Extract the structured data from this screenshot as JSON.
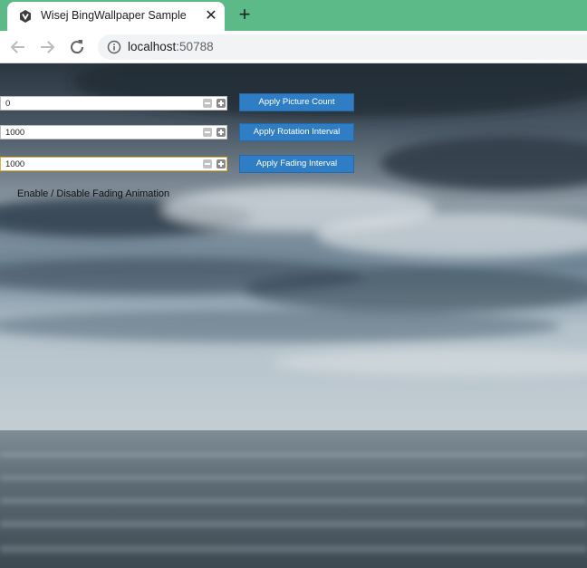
{
  "browser": {
    "tab_title": "Wisej BingWallpaper Sample",
    "close_glyph": "✕",
    "new_tab_glyph": "+",
    "url_host": "localhost",
    "url_port": ":50788",
    "icons": [
      "wisej-favicon-icon",
      "close-icon",
      "plus-icon",
      "back-arrow-icon",
      "forward-arrow-icon",
      "reload-icon",
      "info-icon"
    ]
  },
  "controls": {
    "picture_count": {
      "value": "0",
      "button_label": "Apply Picture Count"
    },
    "rotation_interval": {
      "value": "1000",
      "button_label": "Apply Rotation Interval"
    },
    "fading_interval": {
      "value": "1000",
      "button_label": "Apply Fading Interval"
    },
    "fading_toggle_label": "Enable / Disable Fading Animation"
  },
  "colors": {
    "tab_strip": "#5bba87",
    "button_blue": "#2f7dc4",
    "focus_border": "#e0b23c"
  }
}
